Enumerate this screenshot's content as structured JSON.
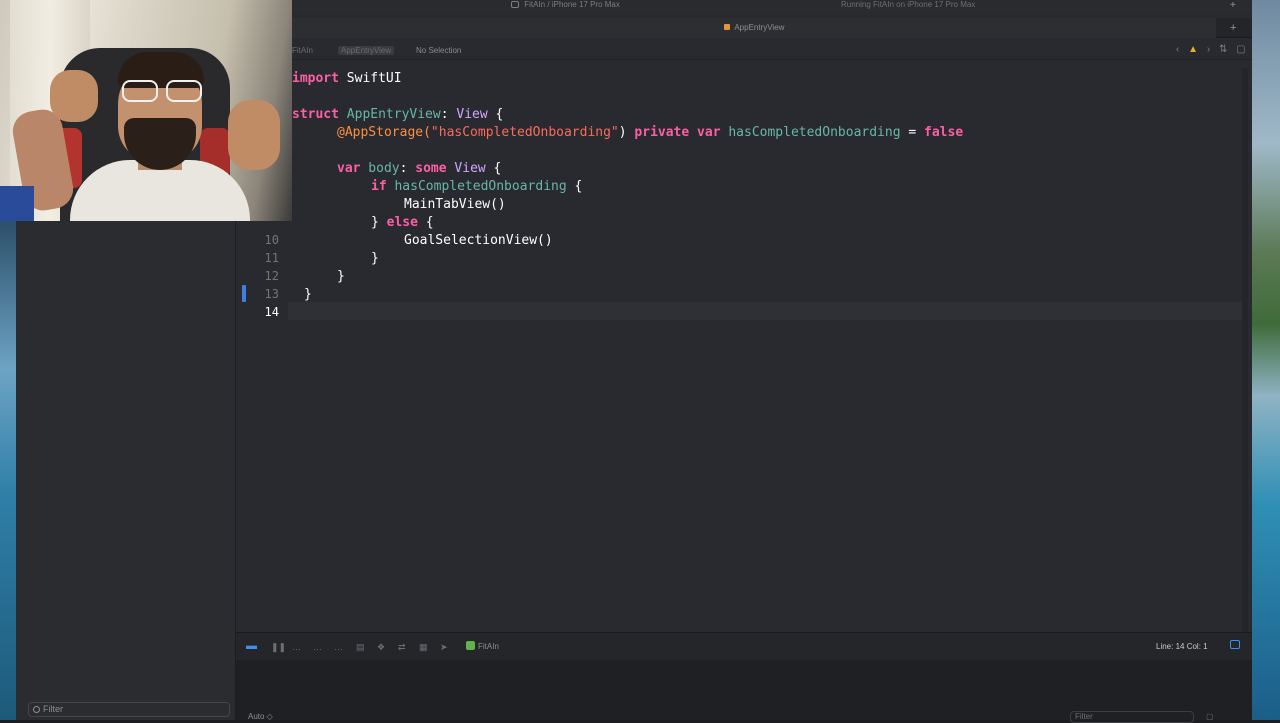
{
  "window": {
    "scheme": "FitAIn",
    "device": "iPhone 17 Pro Max",
    "run_status": "Running FitAIn on iPhone 17 Pro Max"
  },
  "tab": {
    "title": "AppEntryView"
  },
  "jumpbar": {
    "project": "FitAIn",
    "file": "AppEntryView",
    "selection": "No Selection"
  },
  "editor": {
    "line_numbers": [
      "10",
      "11",
      "12",
      "13",
      "14"
    ],
    "lines": {
      "l1_kw": "import",
      "l1_rest": " SwiftUI",
      "l3_kw": "struct",
      "l3_name": " AppEntryView",
      "l3_colon": ": ",
      "l3_type": "View",
      "l3_brace": " {",
      "l4_attr": "@AppStorage(",
      "l4_str": "\"hasCompletedOnboarding\"",
      "l4_close": ") ",
      "l4_kw": "private var",
      "l4_var": " hasCompletedOnboarding",
      "l4_eq": " = ",
      "l4_val": "false",
      "l6_kw": "var",
      "l6_body": " body",
      "l6_colon": ": ",
      "l6_some": "some",
      "l6_type": " View",
      "l6_brace": " {",
      "l7_kw": "if",
      "l7_var": " hasCompletedOnboarding",
      "l7_brace": " {",
      "l8": "MainTabView()",
      "l9_close": "} ",
      "l9_kw": "else",
      "l9_brace": " {",
      "l10": "GoalSelectionView()",
      "l11": "}",
      "l12": "}",
      "l13": "}"
    }
  },
  "debug": {
    "target": "FitAIn",
    "line_col": "Line: 14  Col: 1"
  },
  "navigator": {
    "filter_placeholder": "Filter"
  },
  "console": {
    "mode": "Auto ◇",
    "filter_placeholder": "Filter"
  },
  "colors": {
    "keyword": "#fc5fa3",
    "type": "#d0a8ff",
    "function": "#67b7a4",
    "string": "#fc6a5d",
    "attribute": "#fd8f3f",
    "accent": "#3f8ef0"
  }
}
